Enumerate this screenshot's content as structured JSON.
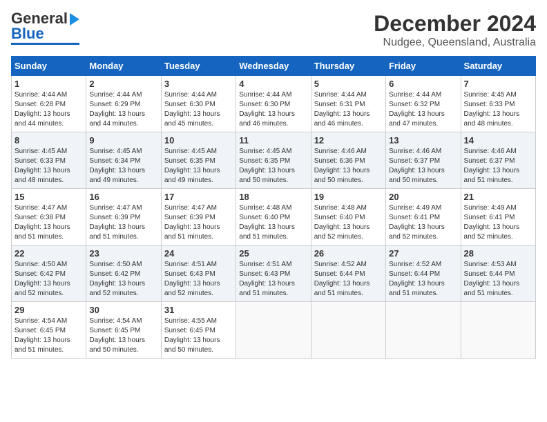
{
  "logo": {
    "line1": "General",
    "line2": "Blue"
  },
  "title": "December 2024",
  "subtitle": "Nudgee, Queensland, Australia",
  "days_of_week": [
    "Sunday",
    "Monday",
    "Tuesday",
    "Wednesday",
    "Thursday",
    "Friday",
    "Saturday"
  ],
  "weeks": [
    [
      {
        "day": "1",
        "detail": "Sunrise: 4:44 AM\nSunset: 6:28 PM\nDaylight: 13 hours\nand 44 minutes."
      },
      {
        "day": "2",
        "detail": "Sunrise: 4:44 AM\nSunset: 6:29 PM\nDaylight: 13 hours\nand 44 minutes."
      },
      {
        "day": "3",
        "detail": "Sunrise: 4:44 AM\nSunset: 6:30 PM\nDaylight: 13 hours\nand 45 minutes."
      },
      {
        "day": "4",
        "detail": "Sunrise: 4:44 AM\nSunset: 6:30 PM\nDaylight: 13 hours\nand 46 minutes."
      },
      {
        "day": "5",
        "detail": "Sunrise: 4:44 AM\nSunset: 6:31 PM\nDaylight: 13 hours\nand 46 minutes."
      },
      {
        "day": "6",
        "detail": "Sunrise: 4:44 AM\nSunset: 6:32 PM\nDaylight: 13 hours\nand 47 minutes."
      },
      {
        "day": "7",
        "detail": "Sunrise: 4:45 AM\nSunset: 6:33 PM\nDaylight: 13 hours\nand 48 minutes."
      }
    ],
    [
      {
        "day": "8",
        "detail": "Sunrise: 4:45 AM\nSunset: 6:33 PM\nDaylight: 13 hours\nand 48 minutes."
      },
      {
        "day": "9",
        "detail": "Sunrise: 4:45 AM\nSunset: 6:34 PM\nDaylight: 13 hours\nand 49 minutes."
      },
      {
        "day": "10",
        "detail": "Sunrise: 4:45 AM\nSunset: 6:35 PM\nDaylight: 13 hours\nand 49 minutes."
      },
      {
        "day": "11",
        "detail": "Sunrise: 4:45 AM\nSunset: 6:35 PM\nDaylight: 13 hours\nand 50 minutes."
      },
      {
        "day": "12",
        "detail": "Sunrise: 4:46 AM\nSunset: 6:36 PM\nDaylight: 13 hours\nand 50 minutes."
      },
      {
        "day": "13",
        "detail": "Sunrise: 4:46 AM\nSunset: 6:37 PM\nDaylight: 13 hours\nand 50 minutes."
      },
      {
        "day": "14",
        "detail": "Sunrise: 4:46 AM\nSunset: 6:37 PM\nDaylight: 13 hours\nand 51 minutes."
      }
    ],
    [
      {
        "day": "15",
        "detail": "Sunrise: 4:47 AM\nSunset: 6:38 PM\nDaylight: 13 hours\nand 51 minutes."
      },
      {
        "day": "16",
        "detail": "Sunrise: 4:47 AM\nSunset: 6:39 PM\nDaylight: 13 hours\nand 51 minutes."
      },
      {
        "day": "17",
        "detail": "Sunrise: 4:47 AM\nSunset: 6:39 PM\nDaylight: 13 hours\nand 51 minutes."
      },
      {
        "day": "18",
        "detail": "Sunrise: 4:48 AM\nSunset: 6:40 PM\nDaylight: 13 hours\nand 51 minutes."
      },
      {
        "day": "19",
        "detail": "Sunrise: 4:48 AM\nSunset: 6:40 PM\nDaylight: 13 hours\nand 52 minutes."
      },
      {
        "day": "20",
        "detail": "Sunrise: 4:49 AM\nSunset: 6:41 PM\nDaylight: 13 hours\nand 52 minutes."
      },
      {
        "day": "21",
        "detail": "Sunrise: 4:49 AM\nSunset: 6:41 PM\nDaylight: 13 hours\nand 52 minutes."
      }
    ],
    [
      {
        "day": "22",
        "detail": "Sunrise: 4:50 AM\nSunset: 6:42 PM\nDaylight: 13 hours\nand 52 minutes."
      },
      {
        "day": "23",
        "detail": "Sunrise: 4:50 AM\nSunset: 6:42 PM\nDaylight: 13 hours\nand 52 minutes."
      },
      {
        "day": "24",
        "detail": "Sunrise: 4:51 AM\nSunset: 6:43 PM\nDaylight: 13 hours\nand 52 minutes."
      },
      {
        "day": "25",
        "detail": "Sunrise: 4:51 AM\nSunset: 6:43 PM\nDaylight: 13 hours\nand 51 minutes."
      },
      {
        "day": "26",
        "detail": "Sunrise: 4:52 AM\nSunset: 6:44 PM\nDaylight: 13 hours\nand 51 minutes."
      },
      {
        "day": "27",
        "detail": "Sunrise: 4:52 AM\nSunset: 6:44 PM\nDaylight: 13 hours\nand 51 minutes."
      },
      {
        "day": "28",
        "detail": "Sunrise: 4:53 AM\nSunset: 6:44 PM\nDaylight: 13 hours\nand 51 minutes."
      }
    ],
    [
      {
        "day": "29",
        "detail": "Sunrise: 4:54 AM\nSunset: 6:45 PM\nDaylight: 13 hours\nand 51 minutes."
      },
      {
        "day": "30",
        "detail": "Sunrise: 4:54 AM\nSunset: 6:45 PM\nDaylight: 13 hours\nand 50 minutes."
      },
      {
        "day": "31",
        "detail": "Sunrise: 4:55 AM\nSunset: 6:45 PM\nDaylight: 13 hours\nand 50 minutes."
      },
      {
        "day": "",
        "detail": ""
      },
      {
        "day": "",
        "detail": ""
      },
      {
        "day": "",
        "detail": ""
      },
      {
        "day": "",
        "detail": ""
      }
    ]
  ]
}
